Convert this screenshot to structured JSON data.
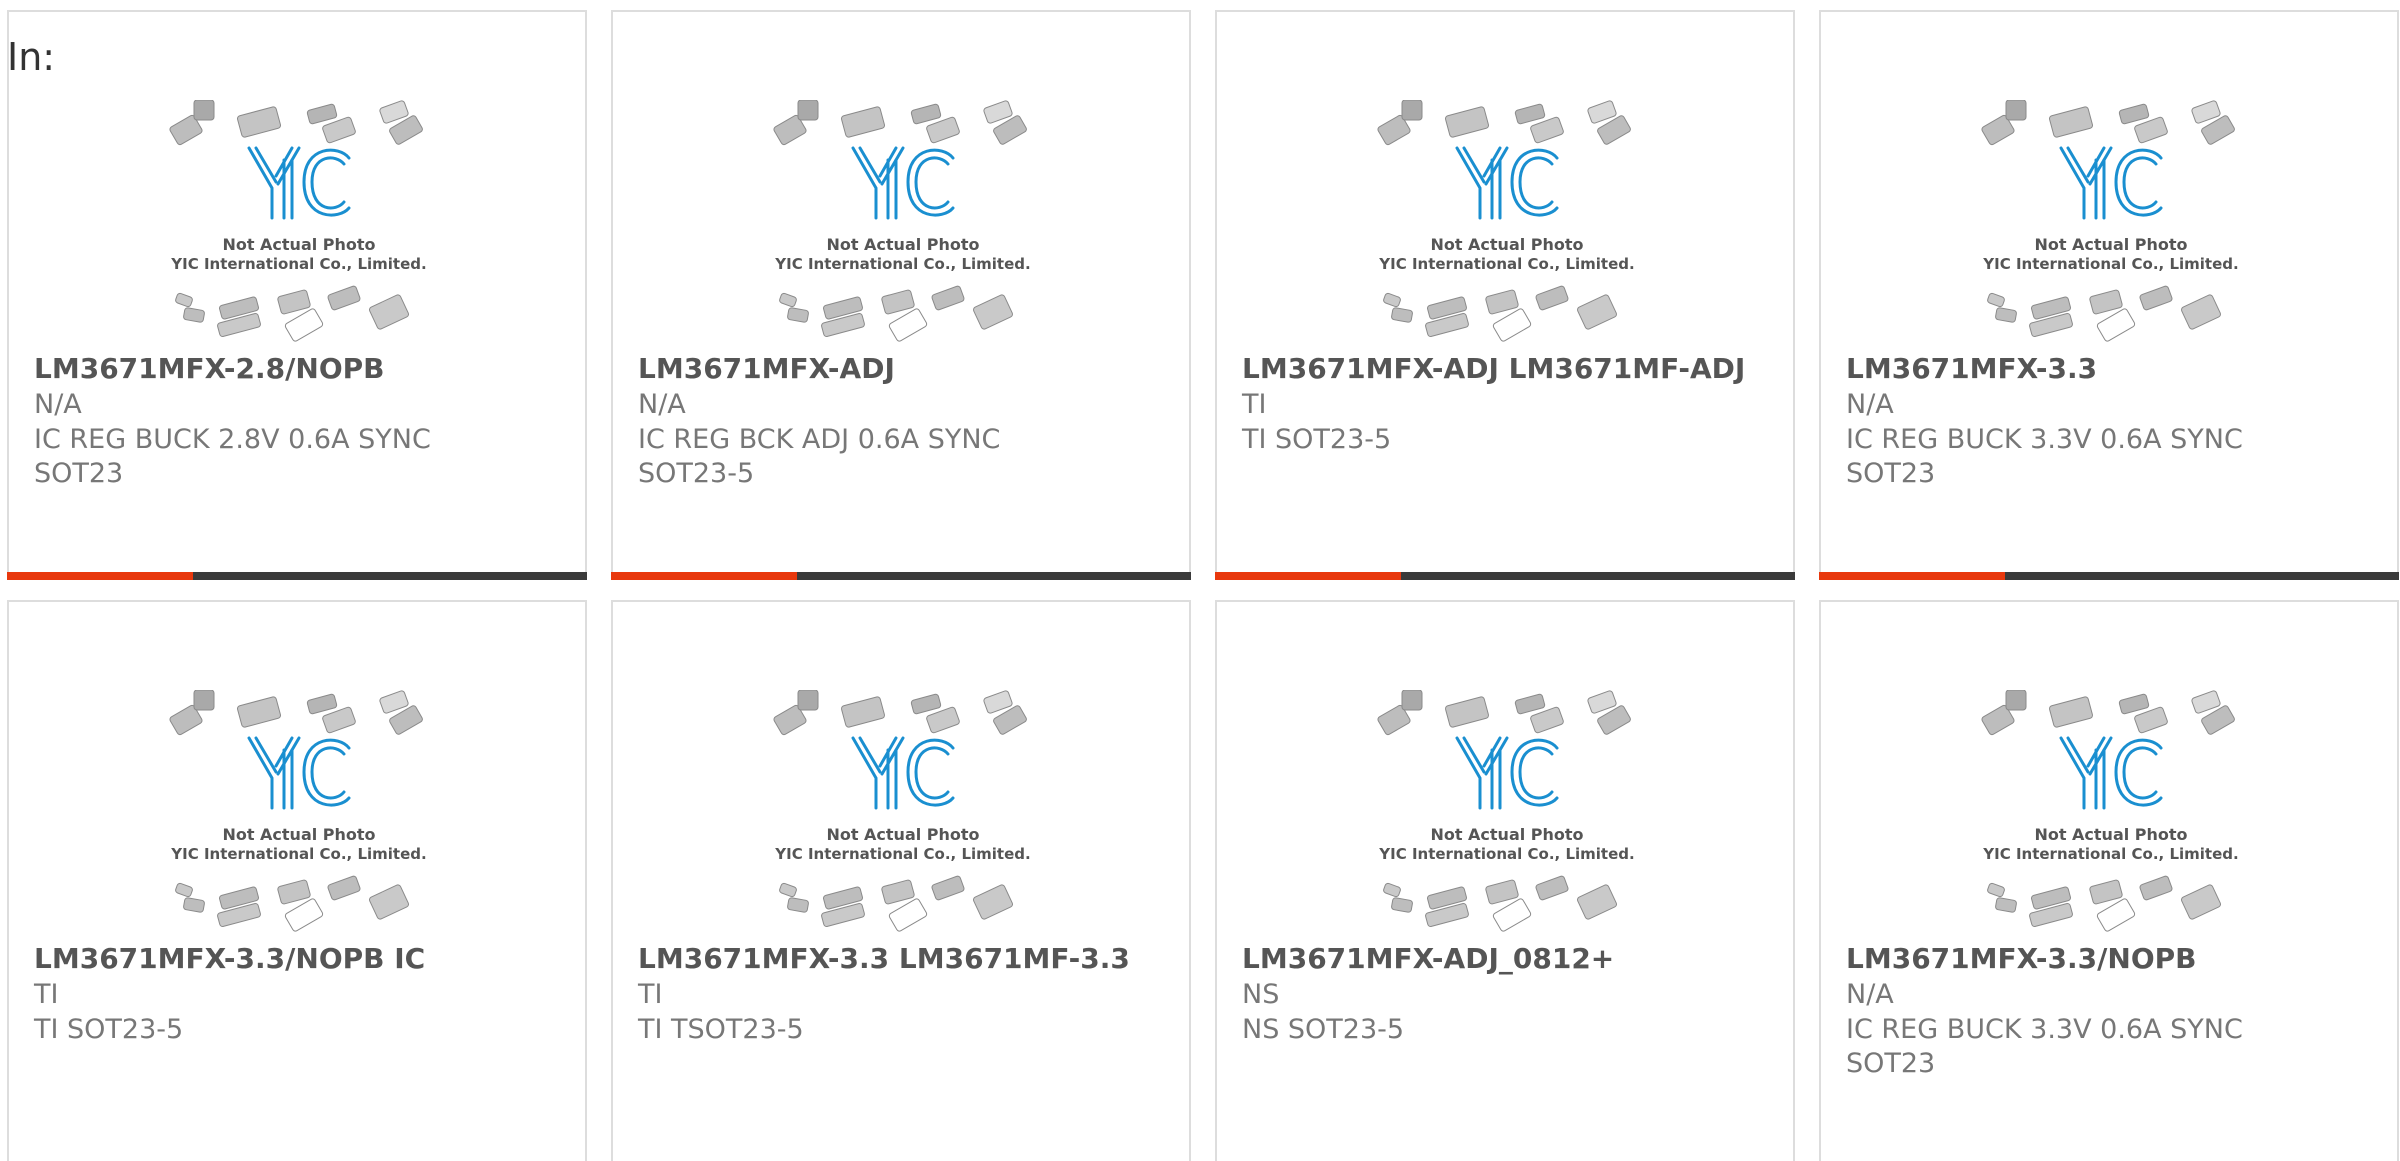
{
  "header": {
    "label": "In:"
  },
  "placeholder": {
    "line1": "Not Actual Photo",
    "line2": "YIC International Co., Limited.",
    "logo": "YIC"
  },
  "colors": {
    "accent": "#e8380d",
    "bar": "#3a3a3a",
    "logo": "#1a8fd0"
  },
  "products": [
    {
      "name": "LM3671MFX-2.8/NOPB",
      "maker": "N/A",
      "desc": "IC REG BUCK 2.8V 0.6A SYNC SOT23",
      "progress": 0.32
    },
    {
      "name": "LM3671MFX-ADJ",
      "maker": "N/A",
      "desc": "IC REG BCK ADJ 0.6A SYNC SOT23-5",
      "progress": 0.32
    },
    {
      "name": "LM3671MFX-ADJ LM3671MF-ADJ",
      "maker": "TI",
      "desc": "TI SOT23-5",
      "progress": 0.32
    },
    {
      "name": "LM3671MFX-3.3",
      "maker": "N/A",
      "desc": "IC REG BUCK 3.3V 0.6A SYNC SOT23",
      "progress": 0.32
    },
    {
      "name": "LM3671MFX-3.3/NOPB IC",
      "maker": "TI",
      "desc": "TI SOT23-5"
    },
    {
      "name": "LM3671MFX-3.3 LM3671MF-3.3",
      "maker": "TI",
      "desc": "TI TSOT23-5"
    },
    {
      "name": "LM3671MFX-ADJ_0812+",
      "maker": "NS",
      "desc": "NS SOT23-5"
    },
    {
      "name": "LM3671MFX-3.3/NOPB",
      "maker": "N/A",
      "desc": "IC REG BUCK 3.3V 0.6A SYNC SOT23"
    }
  ]
}
